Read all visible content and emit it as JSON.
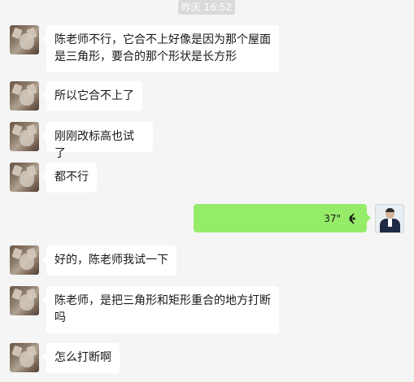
{
  "timestamp": "昨天 16:52",
  "messages": [
    {
      "id": 0,
      "side": "left",
      "text": "陈老师不行，它合不上好像是因为那个屋面是三角形，要合的那个形状是长方形"
    },
    {
      "id": 1,
      "side": "left",
      "text": "所以它合不上了"
    },
    {
      "id": 2,
      "side": "left",
      "text": "刚刚改标高也试了"
    },
    {
      "id": 3,
      "side": "left",
      "text": "都不行"
    },
    {
      "id": 4,
      "side": "right",
      "type": "voice",
      "duration": "37\""
    },
    {
      "id": 5,
      "side": "left",
      "text": "好的，陈老师我试一下"
    },
    {
      "id": 6,
      "side": "left",
      "text": "陈老师，是把三角形和矩形重合的地方打断吗"
    },
    {
      "id": 7,
      "side": "left",
      "text": "怎么打断啊"
    }
  ]
}
